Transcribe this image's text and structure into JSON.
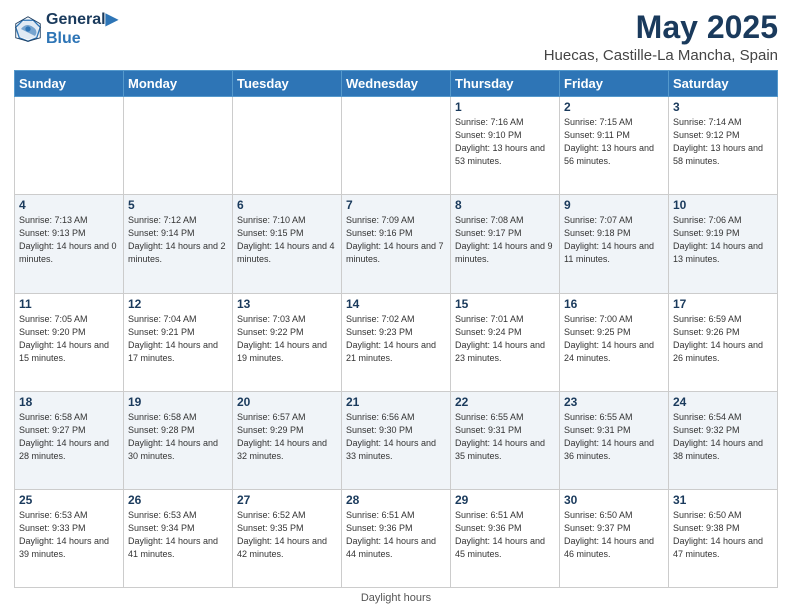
{
  "logo": {
    "line1": "General",
    "line2": "Blue"
  },
  "title": "May 2025",
  "subtitle": "Huecas, Castille-La Mancha, Spain",
  "days_of_week": [
    "Sunday",
    "Monday",
    "Tuesday",
    "Wednesday",
    "Thursday",
    "Friday",
    "Saturday"
  ],
  "footer_label": "Daylight hours",
  "weeks": [
    [
      {
        "day": "",
        "sunrise": "",
        "sunset": "",
        "daylight": ""
      },
      {
        "day": "",
        "sunrise": "",
        "sunset": "",
        "daylight": ""
      },
      {
        "day": "",
        "sunrise": "",
        "sunset": "",
        "daylight": ""
      },
      {
        "day": "",
        "sunrise": "",
        "sunset": "",
        "daylight": ""
      },
      {
        "day": "1",
        "sunrise": "Sunrise: 7:16 AM",
        "sunset": "Sunset: 9:10 PM",
        "daylight": "Daylight: 13 hours and 53 minutes."
      },
      {
        "day": "2",
        "sunrise": "Sunrise: 7:15 AM",
        "sunset": "Sunset: 9:11 PM",
        "daylight": "Daylight: 13 hours and 56 minutes."
      },
      {
        "day": "3",
        "sunrise": "Sunrise: 7:14 AM",
        "sunset": "Sunset: 9:12 PM",
        "daylight": "Daylight: 13 hours and 58 minutes."
      }
    ],
    [
      {
        "day": "4",
        "sunrise": "Sunrise: 7:13 AM",
        "sunset": "Sunset: 9:13 PM",
        "daylight": "Daylight: 14 hours and 0 minutes."
      },
      {
        "day": "5",
        "sunrise": "Sunrise: 7:12 AM",
        "sunset": "Sunset: 9:14 PM",
        "daylight": "Daylight: 14 hours and 2 minutes."
      },
      {
        "day": "6",
        "sunrise": "Sunrise: 7:10 AM",
        "sunset": "Sunset: 9:15 PM",
        "daylight": "Daylight: 14 hours and 4 minutes."
      },
      {
        "day": "7",
        "sunrise": "Sunrise: 7:09 AM",
        "sunset": "Sunset: 9:16 PM",
        "daylight": "Daylight: 14 hours and 7 minutes."
      },
      {
        "day": "8",
        "sunrise": "Sunrise: 7:08 AM",
        "sunset": "Sunset: 9:17 PM",
        "daylight": "Daylight: 14 hours and 9 minutes."
      },
      {
        "day": "9",
        "sunrise": "Sunrise: 7:07 AM",
        "sunset": "Sunset: 9:18 PM",
        "daylight": "Daylight: 14 hours and 11 minutes."
      },
      {
        "day": "10",
        "sunrise": "Sunrise: 7:06 AM",
        "sunset": "Sunset: 9:19 PM",
        "daylight": "Daylight: 14 hours and 13 minutes."
      }
    ],
    [
      {
        "day": "11",
        "sunrise": "Sunrise: 7:05 AM",
        "sunset": "Sunset: 9:20 PM",
        "daylight": "Daylight: 14 hours and 15 minutes."
      },
      {
        "day": "12",
        "sunrise": "Sunrise: 7:04 AM",
        "sunset": "Sunset: 9:21 PM",
        "daylight": "Daylight: 14 hours and 17 minutes."
      },
      {
        "day": "13",
        "sunrise": "Sunrise: 7:03 AM",
        "sunset": "Sunset: 9:22 PM",
        "daylight": "Daylight: 14 hours and 19 minutes."
      },
      {
        "day": "14",
        "sunrise": "Sunrise: 7:02 AM",
        "sunset": "Sunset: 9:23 PM",
        "daylight": "Daylight: 14 hours and 21 minutes."
      },
      {
        "day": "15",
        "sunrise": "Sunrise: 7:01 AM",
        "sunset": "Sunset: 9:24 PM",
        "daylight": "Daylight: 14 hours and 23 minutes."
      },
      {
        "day": "16",
        "sunrise": "Sunrise: 7:00 AM",
        "sunset": "Sunset: 9:25 PM",
        "daylight": "Daylight: 14 hours and 24 minutes."
      },
      {
        "day": "17",
        "sunrise": "Sunrise: 6:59 AM",
        "sunset": "Sunset: 9:26 PM",
        "daylight": "Daylight: 14 hours and 26 minutes."
      }
    ],
    [
      {
        "day": "18",
        "sunrise": "Sunrise: 6:58 AM",
        "sunset": "Sunset: 9:27 PM",
        "daylight": "Daylight: 14 hours and 28 minutes."
      },
      {
        "day": "19",
        "sunrise": "Sunrise: 6:58 AM",
        "sunset": "Sunset: 9:28 PM",
        "daylight": "Daylight: 14 hours and 30 minutes."
      },
      {
        "day": "20",
        "sunrise": "Sunrise: 6:57 AM",
        "sunset": "Sunset: 9:29 PM",
        "daylight": "Daylight: 14 hours and 32 minutes."
      },
      {
        "day": "21",
        "sunrise": "Sunrise: 6:56 AM",
        "sunset": "Sunset: 9:30 PM",
        "daylight": "Daylight: 14 hours and 33 minutes."
      },
      {
        "day": "22",
        "sunrise": "Sunrise: 6:55 AM",
        "sunset": "Sunset: 9:31 PM",
        "daylight": "Daylight: 14 hours and 35 minutes."
      },
      {
        "day": "23",
        "sunrise": "Sunrise: 6:55 AM",
        "sunset": "Sunset: 9:31 PM",
        "daylight": "Daylight: 14 hours and 36 minutes."
      },
      {
        "day": "24",
        "sunrise": "Sunrise: 6:54 AM",
        "sunset": "Sunset: 9:32 PM",
        "daylight": "Daylight: 14 hours and 38 minutes."
      }
    ],
    [
      {
        "day": "25",
        "sunrise": "Sunrise: 6:53 AM",
        "sunset": "Sunset: 9:33 PM",
        "daylight": "Daylight: 14 hours and 39 minutes."
      },
      {
        "day": "26",
        "sunrise": "Sunrise: 6:53 AM",
        "sunset": "Sunset: 9:34 PM",
        "daylight": "Daylight: 14 hours and 41 minutes."
      },
      {
        "day": "27",
        "sunrise": "Sunrise: 6:52 AM",
        "sunset": "Sunset: 9:35 PM",
        "daylight": "Daylight: 14 hours and 42 minutes."
      },
      {
        "day": "28",
        "sunrise": "Sunrise: 6:51 AM",
        "sunset": "Sunset: 9:36 PM",
        "daylight": "Daylight: 14 hours and 44 minutes."
      },
      {
        "day": "29",
        "sunrise": "Sunrise: 6:51 AM",
        "sunset": "Sunset: 9:36 PM",
        "daylight": "Daylight: 14 hours and 45 minutes."
      },
      {
        "day": "30",
        "sunrise": "Sunrise: 6:50 AM",
        "sunset": "Sunset: 9:37 PM",
        "daylight": "Daylight: 14 hours and 46 minutes."
      },
      {
        "day": "31",
        "sunrise": "Sunrise: 6:50 AM",
        "sunset": "Sunset: 9:38 PM",
        "daylight": "Daylight: 14 hours and 47 minutes."
      }
    ]
  ]
}
